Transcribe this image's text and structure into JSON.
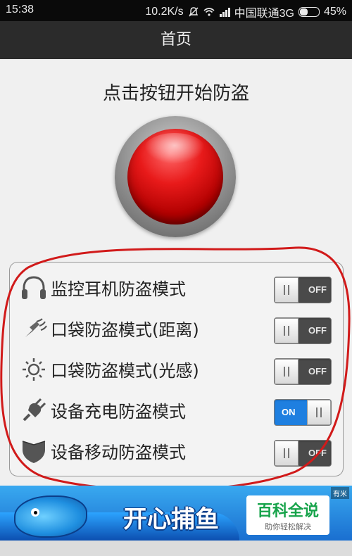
{
  "status_bar": {
    "time": "15:38",
    "speed": "10.2K/s",
    "carrier": "中国联通3G",
    "battery_percent": "45%",
    "battery_level": 0.45,
    "icons": [
      "bell-muted-icon",
      "wifi-icon",
      "signal-icon",
      "battery-icon"
    ]
  },
  "title_bar": {
    "title": "首页"
  },
  "main": {
    "instruction": "点击按钮开始防盗",
    "big_button_color": "#e81a1a"
  },
  "options": [
    {
      "label": "监控耳机防盗模式",
      "icon": "headphones-icon",
      "state": "OFF",
      "on": false
    },
    {
      "label": "口袋防盗模式(距离)",
      "icon": "proximity-icon",
      "state": "OFF",
      "on": false
    },
    {
      "label": "口袋防盗模式(光感)",
      "icon": "light-sensor-icon",
      "state": "OFF",
      "on": false
    },
    {
      "label": "设备充电防盗模式",
      "icon": "plug-icon",
      "state": "ON",
      "on": true
    },
    {
      "label": "设备移动防盗模式",
      "icon": "shield-icon",
      "state": "OFF",
      "on": false
    }
  ],
  "banner": {
    "title": "开心捕鱼",
    "mark": "有米"
  },
  "watermark": {
    "title": "百科全说",
    "subtitle": "助你轻松解决"
  },
  "colors": {
    "switch_on": "#1e7fe0",
    "switch_off": "#4a4a4a",
    "annotation": "#d11a1a"
  }
}
